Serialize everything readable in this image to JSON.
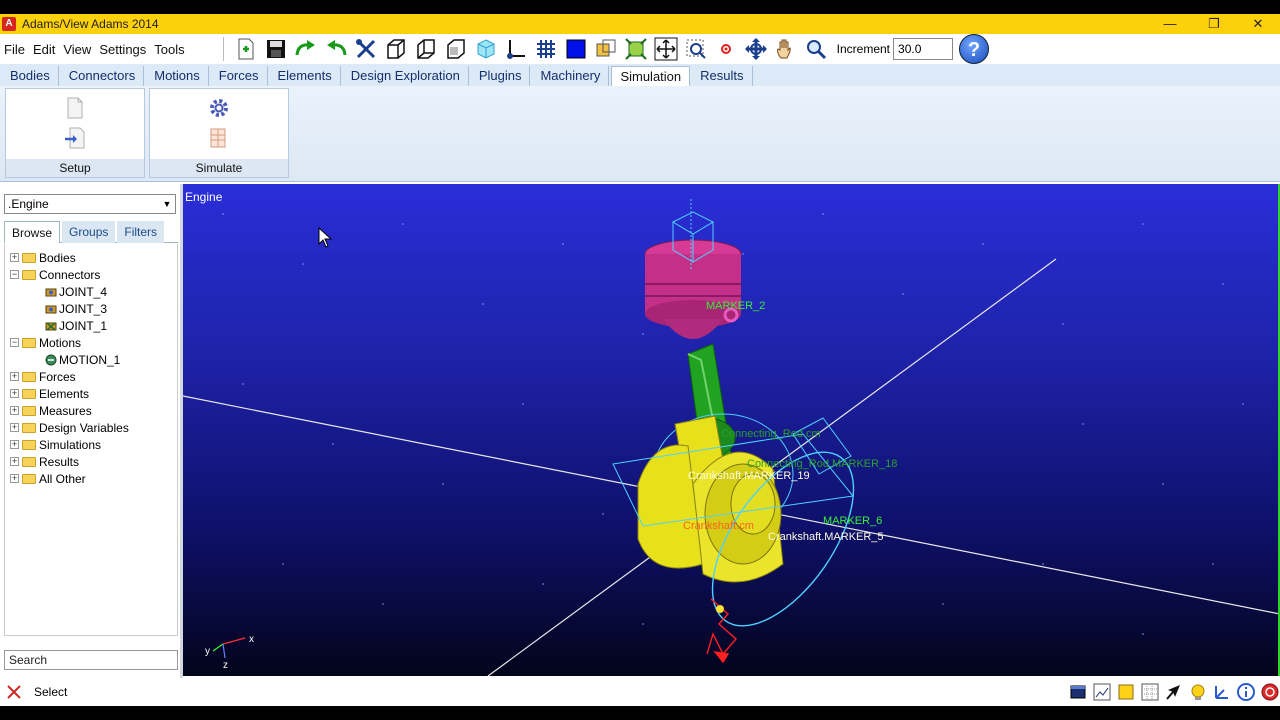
{
  "window": {
    "title": "Adams/View Adams 2014",
    "app_icon_letter": "A"
  },
  "menu": [
    "File",
    "Edit",
    "View",
    "Settings",
    "Tools"
  ],
  "toolbar": {
    "increment_label": "Increment",
    "increment_value": "30.0",
    "help_glyph": "?"
  },
  "tabs": [
    "Bodies",
    "Connectors",
    "Motions",
    "Forces",
    "Elements",
    "Design Exploration",
    "Plugins",
    "Machinery",
    "Simulation",
    "Results"
  ],
  "active_tab": "Simulation",
  "ribbon": {
    "setup_label": "Setup",
    "simulate_label": "Simulate"
  },
  "browser": {
    "model": ".Engine",
    "subtabs": [
      "Browse",
      "Groups",
      "Filters"
    ],
    "tree": {
      "bodies": "Bodies",
      "connectors": "Connectors",
      "joint_4": "JOINT_4",
      "joint_3": "JOINT_3",
      "joint_1": "JOINT_1",
      "motions": "Motions",
      "motion_1": "MOTION_1",
      "forces": "Forces",
      "elements": "Elements",
      "measures": "Measures",
      "design_variables": "Design Variables",
      "simulations": "Simulations",
      "results": "Results",
      "all_other": "All Other"
    },
    "search_placeholder": "Search"
  },
  "viewport": {
    "title": "Engine",
    "labels": {
      "marker_2": "MARKER_2",
      "connecting_rod_cm": "Connecting_Rod.cm",
      "connecting_rod_marker_18": "Connecting_Rod.MARKER_18",
      "crankshaft_marker_19": "Crankshaft.MARKER_19",
      "crankshaft_cm": "Crankshaft.cm",
      "marker_6": "MARKER_6",
      "crankshaft_marker_5": "Crankshaft.MARKER_5"
    },
    "triad": {
      "x": "x",
      "y": "y",
      "z": "z"
    }
  },
  "status": {
    "text": "Select"
  }
}
